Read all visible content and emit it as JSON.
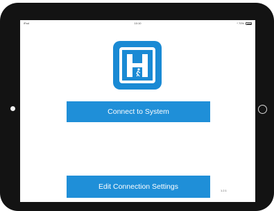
{
  "status_bar": {
    "carrier": "iPad",
    "time": "10:10",
    "battery_text": "* 70%",
    "battery_level": 0.7
  },
  "app": {
    "logo_icon": "h-door-logo-icon",
    "accent_color": "#1f8fd8"
  },
  "buttons": {
    "connect_label": "Connect to System",
    "edit_label": "Edit Connection Settings"
  },
  "version": "1.2.1"
}
